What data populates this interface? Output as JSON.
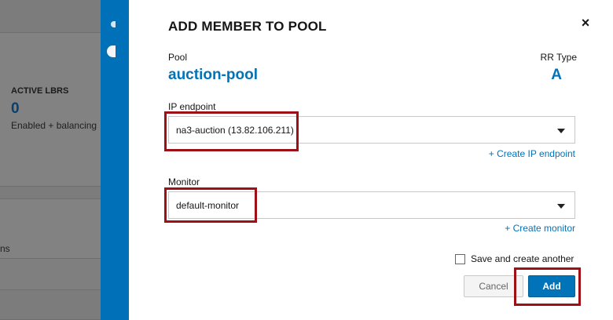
{
  "background": {
    "lbrs_title": "ACTIVE LBRS",
    "lbrs_value": "0",
    "lbrs_sub": "Enabled + balancing",
    "partial_text": "ns"
  },
  "dialog": {
    "title": "ADD MEMBER TO POOL",
    "close_glyph": "×",
    "pool_label": "Pool",
    "pool_value": "auction-pool",
    "rr_type_label": "RR Type",
    "rr_type_value": "A",
    "ip_endpoint_label": "IP endpoint",
    "ip_endpoint_value": "na3-auction (13.82.106.211)",
    "create_ip_endpoint": "+ Create IP endpoint",
    "monitor_label": "Monitor",
    "monitor_value": "default-monitor",
    "create_monitor": "+ Create monitor",
    "save_and_create_another": "Save and create another",
    "save_and_create_checked": false,
    "cancel_label": "Cancel",
    "add_label": "Add"
  },
  "icons": {
    "close": "close-icon",
    "dropdown": "chevron-down-icon"
  },
  "colors": {
    "accent": "#0073b9",
    "highlight": "#9e1016",
    "strip": "#0070b8"
  }
}
